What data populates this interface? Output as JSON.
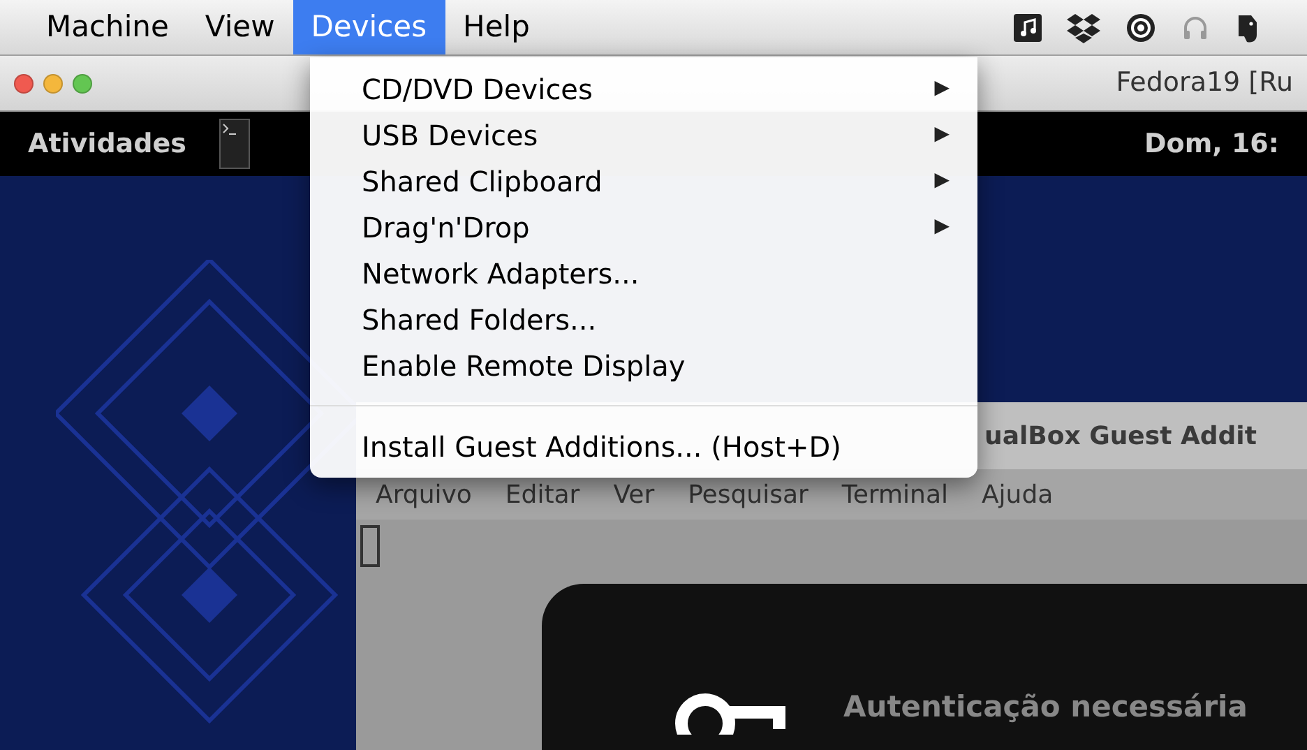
{
  "menu_bar": {
    "items": [
      {
        "label": "Machine",
        "selected": false
      },
      {
        "label": "View",
        "selected": false
      },
      {
        "label": "Devices",
        "selected": true
      },
      {
        "label": "Help",
        "selected": false
      }
    ]
  },
  "devices_menu": {
    "sections": [
      [
        {
          "label": "CD/DVD Devices",
          "kind": "submenu",
          "arrow": "▶"
        },
        {
          "label": "USB Devices",
          "kind": "submenu",
          "arrow": "▶"
        },
        {
          "label": "Shared Clipboard",
          "kind": "submenu",
          "arrow": "▶"
        },
        {
          "label": "Drag'n'Drop",
          "kind": "submenu",
          "arrow": "▶"
        },
        {
          "label": "Network Adapters...",
          "kind": "action"
        },
        {
          "label": "Shared Folders...",
          "kind": "action"
        },
        {
          "label": "Enable Remote Display",
          "kind": "action"
        }
      ],
      [
        {
          "label": "Install Guest Additions... (Host+D)",
          "kind": "action"
        }
      ]
    ]
  },
  "vm_window": {
    "title": "Fedora19 [Ru"
  },
  "guest_top_bar": {
    "activities": "Atividades",
    "clock": "Dom, 16:"
  },
  "terminal_window": {
    "title": "ualBox Guest Addit",
    "menu": [
      "Arquivo",
      "Editar",
      "Ver",
      "Pesquisar",
      "Terminal",
      "Ajuda"
    ]
  },
  "auth_dialog": {
    "title": "Autenticação necessária"
  }
}
